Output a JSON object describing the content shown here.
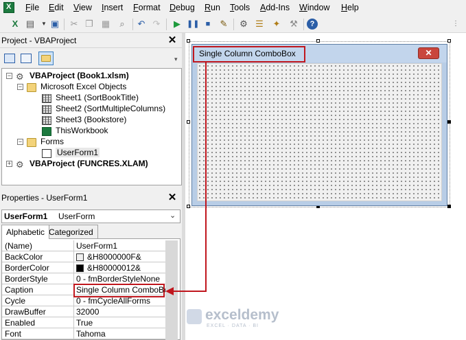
{
  "menu": [
    "File",
    "Edit",
    "View",
    "Insert",
    "Format",
    "Debug",
    "Run",
    "Tools",
    "Add-Ins",
    "Window",
    "Help"
  ],
  "project_panel": {
    "title": "Project - VBAProject",
    "tree": {
      "root1": "VBAProject (Book1.xlsm)",
      "excel_objects": "Microsoft Excel Objects",
      "sheets": [
        "Sheet1 (SortBookTitle)",
        "Sheet2 (SortMultipleColumns)",
        "Sheet3 (Bookstore)",
        "ThisWorkbook"
      ],
      "forms": "Forms",
      "userform": "UserForm1",
      "root2": "VBAProject (FUNCRES.XLAM)"
    }
  },
  "properties_panel": {
    "title": "Properties - UserForm1",
    "object_name": "UserForm1",
    "object_type": "UserForm",
    "tabs": [
      "Alphabetic",
      "Categorized"
    ],
    "rows": [
      {
        "name": "(Name)",
        "value": "UserForm1"
      },
      {
        "name": "BackColor",
        "value": "&H8000000F&",
        "swatch": "#f0f0f0"
      },
      {
        "name": "BorderColor",
        "value": "&H80000012&",
        "swatch": "#000000"
      },
      {
        "name": "BorderStyle",
        "value": "0 - fmBorderStyleNone"
      },
      {
        "name": "Caption",
        "value": "Single Column ComboBox"
      },
      {
        "name": "Cycle",
        "value": "0 - fmCycleAllForms"
      },
      {
        "name": "DrawBuffer",
        "value": "32000"
      },
      {
        "name": "Enabled",
        "value": "True"
      },
      {
        "name": "Font",
        "value": "Tahoma"
      }
    ]
  },
  "form_designer": {
    "caption": "Single Column ComboBox",
    "close_glyph": "✕"
  },
  "watermark": {
    "name": "exceldemy",
    "tagline": "EXCEL · DATA · BI"
  },
  "colors": {
    "highlight": "#c0161d",
    "form_frame": "#b8cde6",
    "close_button": "#c9463d"
  }
}
